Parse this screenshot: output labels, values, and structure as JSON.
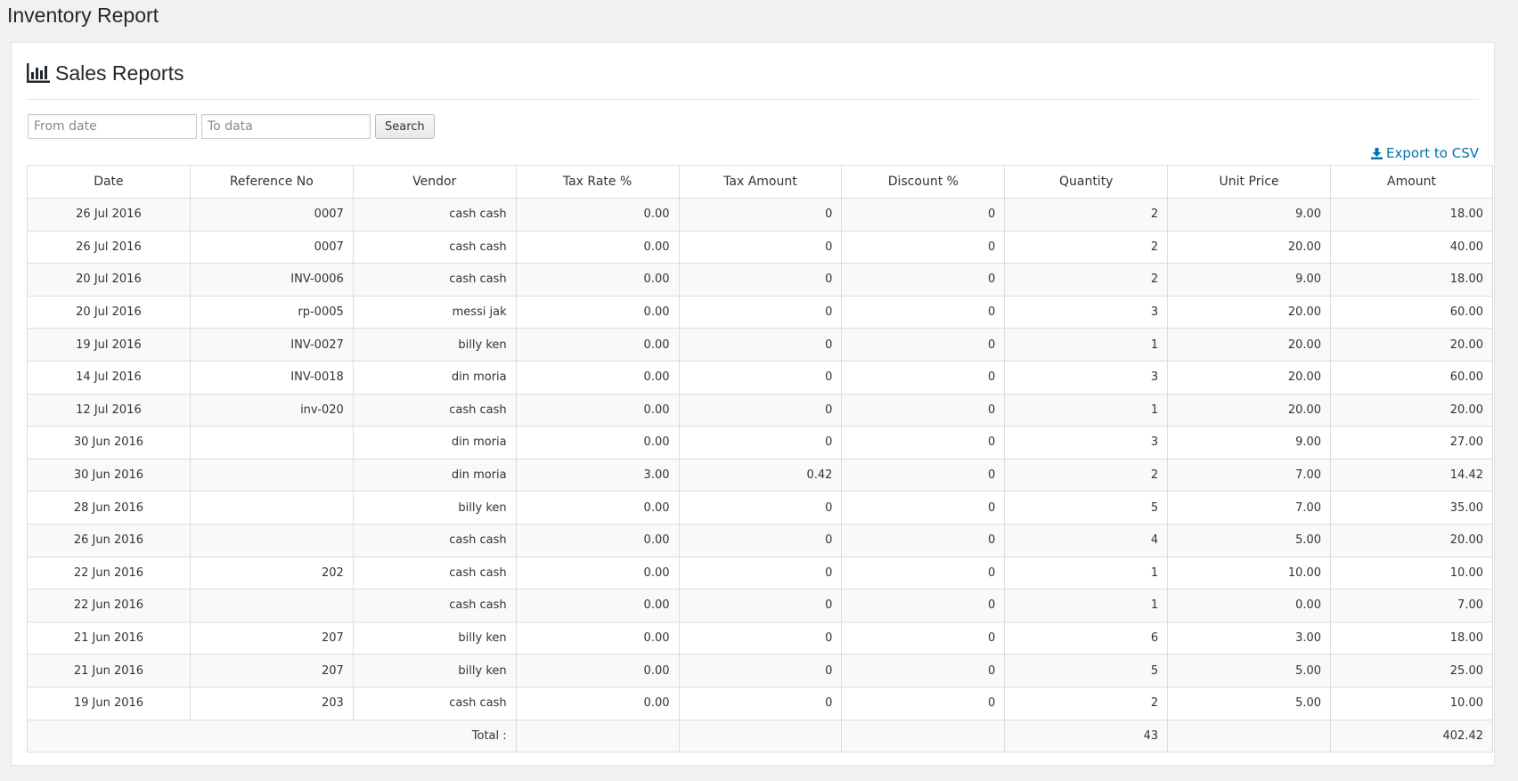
{
  "page_title": "Inventory Report",
  "panel_title": "Sales Reports",
  "filters": {
    "from_placeholder": "From date",
    "to_placeholder": "To data",
    "search_label": "Search"
  },
  "export_label": "Export to CSV",
  "columns": [
    "Date",
    "Reference No",
    "Vendor",
    "Tax Rate %",
    "Tax Amount",
    "Discount %",
    "Quantity",
    "Unit Price",
    "Amount"
  ],
  "rows": [
    [
      "26 Jul 2016",
      "0007",
      "cash cash",
      "0.00",
      "0",
      "0",
      "2",
      "9.00",
      "18.00"
    ],
    [
      "26 Jul 2016",
      "0007",
      "cash cash",
      "0.00",
      "0",
      "0",
      "2",
      "20.00",
      "40.00"
    ],
    [
      "20 Jul 2016",
      "INV-0006",
      "cash cash",
      "0.00",
      "0",
      "0",
      "2",
      "9.00",
      "18.00"
    ],
    [
      "20 Jul 2016",
      "rp-0005",
      "messi jak",
      "0.00",
      "0",
      "0",
      "3",
      "20.00",
      "60.00"
    ],
    [
      "19 Jul 2016",
      "INV-0027",
      "billy ken",
      "0.00",
      "0",
      "0",
      "1",
      "20.00",
      "20.00"
    ],
    [
      "14 Jul 2016",
      "INV-0018",
      "din moria",
      "0.00",
      "0",
      "0",
      "3",
      "20.00",
      "60.00"
    ],
    [
      "12 Jul 2016",
      "inv-020",
      "cash cash",
      "0.00",
      "0",
      "0",
      "1",
      "20.00",
      "20.00"
    ],
    [
      "30 Jun 2016",
      "",
      "din moria",
      "0.00",
      "0",
      "0",
      "3",
      "9.00",
      "27.00"
    ],
    [
      "30 Jun 2016",
      "",
      "din moria",
      "3.00",
      "0.42",
      "0",
      "2",
      "7.00",
      "14.42"
    ],
    [
      "28 Jun 2016",
      "",
      "billy ken",
      "0.00",
      "0",
      "0",
      "5",
      "7.00",
      "35.00"
    ],
    [
      "26 Jun 2016",
      "",
      "cash cash",
      "0.00",
      "0",
      "0",
      "4",
      "5.00",
      "20.00"
    ],
    [
      "22 Jun 2016",
      "202",
      "cash cash",
      "0.00",
      "0",
      "0",
      "1",
      "10.00",
      "10.00"
    ],
    [
      "22 Jun 2016",
      "",
      "cash cash",
      "0.00",
      "0",
      "0",
      "1",
      "0.00",
      "7.00"
    ],
    [
      "21 Jun 2016",
      "207",
      "billy ken",
      "0.00",
      "0",
      "0",
      "6",
      "3.00",
      "18.00"
    ],
    [
      "21 Jun 2016",
      "207",
      "billy ken",
      "0.00",
      "0",
      "0",
      "5",
      "5.00",
      "25.00"
    ],
    [
      "19 Jun 2016",
      "203",
      "cash cash",
      "0.00",
      "0",
      "0",
      "2",
      "5.00",
      "10.00"
    ]
  ],
  "totals": {
    "label": "Total :",
    "quantity": "43",
    "amount": "402.42"
  },
  "colors": {
    "link": "#0073aa",
    "stripe": "#f9f9f9",
    "border": "#dddddd"
  },
  "icons": {
    "panel": "bar-chart-icon",
    "export": "download-icon"
  }
}
